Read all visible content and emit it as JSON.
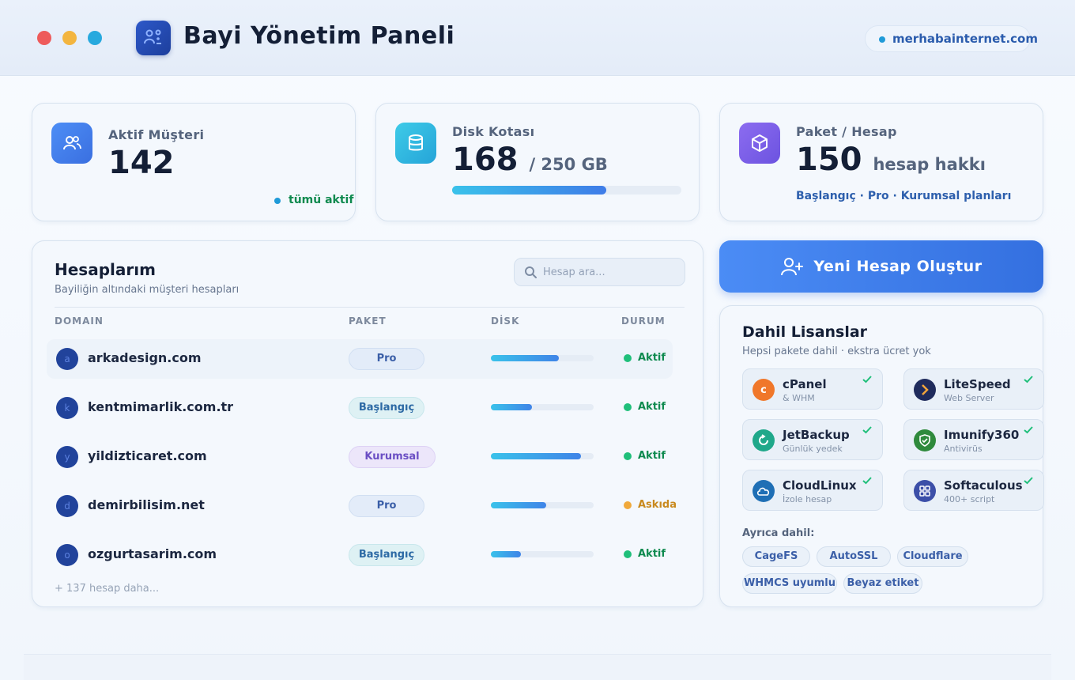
{
  "window": {
    "title": "Bayi Yönetim Paneli",
    "domain": "merhabainternet.com"
  },
  "stats": {
    "customers": {
      "label": "Aktif Müşteri",
      "value": "142",
      "footer": "tümü aktif"
    },
    "disk": {
      "label": "Disk Kotası",
      "value": "168",
      "unit": "/ 250 GB",
      "used_fraction": 0.672
    },
    "package": {
      "label": "Paket / Hesap",
      "value": "150",
      "unit": "hesap hakkı",
      "plans": "Başlangıç · Pro · Kurumsal planları"
    }
  },
  "accounts": {
    "title": "Hesaplarım",
    "subtitle": "Bayiliğin altındaki müşteri hesapları",
    "search_placeholder": "Hesap ara...",
    "columns": [
      "DOMAIN",
      "PAKET",
      "DİSK",
      "DURUM"
    ],
    "rows": [
      {
        "initial": "a",
        "domain": "arkadesign.com",
        "package": "Pro",
        "package_type": "pro",
        "disk_fraction": 0.66,
        "status": "Aktif",
        "status_color": "#1fbf7a",
        "status_text_color": "#0f8a4f"
      },
      {
        "initial": "k",
        "domain": "kentmimarlik.com.tr",
        "package": "Başlangıç",
        "package_type": "bas",
        "disk_fraction": 0.4,
        "status": "Aktif",
        "status_color": "#1fbf7a",
        "status_text_color": "#0f8a4f"
      },
      {
        "initial": "y",
        "domain": "yildizticaret.com",
        "package": "Kurumsal",
        "package_type": "kur",
        "disk_fraction": 0.88,
        "status": "Aktif",
        "status_color": "#1fbf7a",
        "status_text_color": "#0f8a4f"
      },
      {
        "initial": "d",
        "domain": "demirbilisim.net",
        "package": "Pro",
        "package_type": "pro",
        "disk_fraction": 0.54,
        "status": "Askıda",
        "status_color": "#f0a93b",
        "status_text_color": "#c98a1e"
      },
      {
        "initial": "o",
        "domain": "ozgurtasarim.com",
        "package": "Başlangıç",
        "package_type": "bas",
        "disk_fraction": 0.29,
        "status": "Aktif",
        "status_color": "#1fbf7a",
        "status_text_color": "#0f8a4f"
      }
    ],
    "more": "+ 137 hesap daha..."
  },
  "new_account_label": "Yeni Hesap Oluştur",
  "licenses": {
    "title": "Dahil Lisanslar",
    "subtitle": "Hepsi pakete dahil · ekstra ücret yok",
    "items": [
      {
        "name": "cPanel",
        "desc": "& WHM",
        "icon": "cpanel-icon",
        "color": "#f0772a"
      },
      {
        "name": "LiteSpeed",
        "desc": "Web Server",
        "icon": "litespeed-icon",
        "color": "#1f2b5c"
      },
      {
        "name": "JetBackup",
        "desc": "Günlük yedek",
        "icon": "backup-icon",
        "color": "#1fa88a"
      },
      {
        "name": "Imunify360",
        "desc": "Antivirüs",
        "icon": "shield-icon",
        "color": "#2f8a3c"
      },
      {
        "name": "CloudLinux",
        "desc": "İzole hesap",
        "icon": "cloud-icon",
        "color": "#1f6fb5"
      },
      {
        "name": "Softaculous",
        "desc": "400+ script",
        "icon": "grid-icon",
        "color": "#3c4fa8"
      }
    ],
    "also_label": "Ayrıca dahil:",
    "tags": [
      "CageFS",
      "AutoSSL",
      "Cloudflare",
      "WHMCS uyumlu",
      "Beyaz etiket"
    ]
  }
}
